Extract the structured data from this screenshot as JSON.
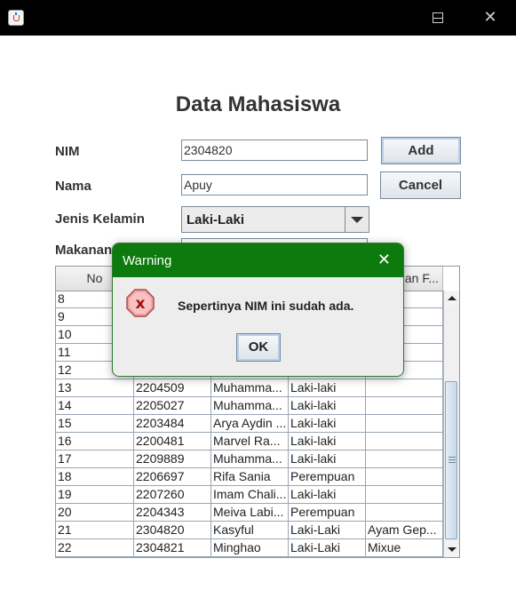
{
  "window": {
    "app_icon": "java-cup-icon"
  },
  "form": {
    "title": "Data Mahasiswa",
    "labels": {
      "nim": "NIM",
      "nama": "Nama",
      "jenis_kelamin": "Jenis Kelamin",
      "makanan": "Makanan"
    },
    "values": {
      "nim": "2304820",
      "nama": "Apuy",
      "jenis_kelamin": "Laki-Laki"
    },
    "buttons": {
      "add": "Add",
      "cancel": "Cancel"
    }
  },
  "table": {
    "headers": [
      "No",
      "",
      "",
      "",
      "an F..."
    ],
    "rows": [
      [
        "8",
        "",
        "",
        "",
        ""
      ],
      [
        "9",
        "",
        "",
        "",
        ""
      ],
      [
        "10",
        "",
        "",
        "",
        ""
      ],
      [
        "11",
        "",
        "",
        "",
        ""
      ],
      [
        "12",
        "",
        "",
        "",
        ""
      ],
      [
        "13",
        "2204509",
        "Muhamma...",
        "Laki-laki",
        ""
      ],
      [
        "14",
        "2205027",
        "Muhamma...",
        "Laki-laki",
        ""
      ],
      [
        "15",
        "2203484",
        "Arya Aydin ...",
        "Laki-laki",
        ""
      ],
      [
        "16",
        "2200481",
        "Marvel Ra...",
        "Laki-laki",
        ""
      ],
      [
        "17",
        "2209889",
        "Muhamma...",
        "Laki-laki",
        ""
      ],
      [
        "18",
        "2206697",
        "Rifa Sania",
        "Perempuan",
        ""
      ],
      [
        "19",
        "2207260",
        "Imam Chali...",
        "Laki-laki",
        ""
      ],
      [
        "20",
        "2204343",
        "Meiva Labi...",
        "Perempuan",
        ""
      ],
      [
        "21",
        "2304820",
        "Kasyful",
        "Laki-Laki",
        "Ayam Gep..."
      ],
      [
        "22",
        "2304821",
        "Minghao",
        "Laki-Laki",
        "Mixue"
      ]
    ]
  },
  "dialog": {
    "title": "Warning",
    "message": "Sepertinya NIM ini sudah ada.",
    "ok": "OK",
    "icon": "error-icon"
  },
  "colors": {
    "dialog_title_bg": "#0d7a0d",
    "window_titlebar": "#000000"
  }
}
